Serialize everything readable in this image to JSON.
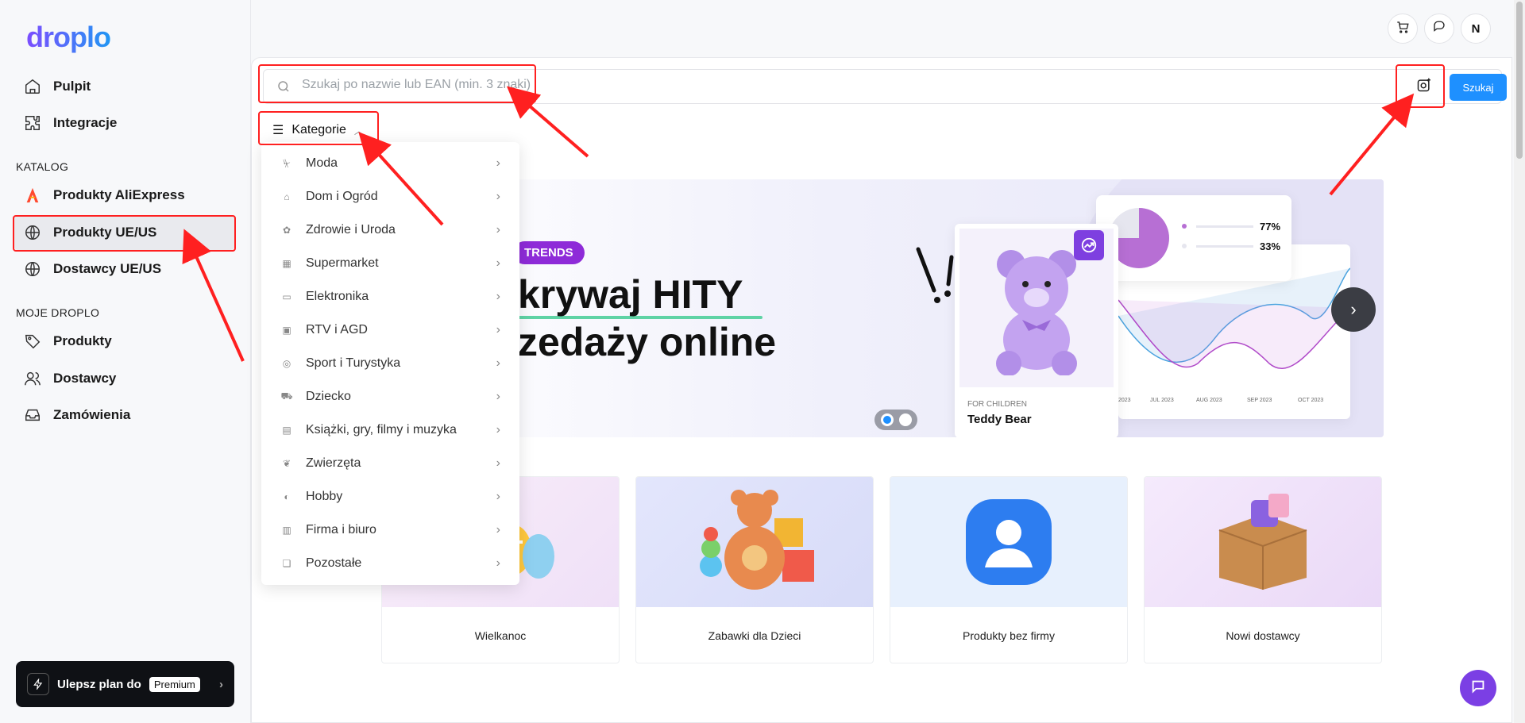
{
  "app": {
    "logo": "droplo",
    "user_initial": "N"
  },
  "sidebar": {
    "top_items": [
      {
        "label": "Pulpit",
        "icon": "home-icon"
      },
      {
        "label": "Integracje",
        "icon": "puzzle-icon"
      }
    ],
    "section_catalog": "KATALOG",
    "catalog_items": [
      {
        "label": "Produkty AliExpress",
        "icon": "aliexpress-icon"
      },
      {
        "label": "Produkty UE/US",
        "icon": "globe-icon",
        "active": true
      },
      {
        "label": "Dostawcy UE/US",
        "icon": "globe-icon"
      }
    ],
    "section_mine": "MOJE DROPLO",
    "mine_items": [
      {
        "label": "Produkty",
        "icon": "tag-icon"
      },
      {
        "label": "Dostawcy",
        "icon": "users-icon"
      },
      {
        "label": "Zamówienia",
        "icon": "inbox-icon"
      }
    ],
    "upgrade": {
      "label": "Ulepsz plan do",
      "badge": "Premium"
    }
  },
  "search": {
    "placeholder": "Szukaj po nazwie lub EAN (min. 3 znaki)",
    "value": "",
    "button": "Szukaj"
  },
  "categories": {
    "toggle_label": "Kategorie",
    "items": [
      "Moda",
      "Dom i Ogród",
      "Zdrowie i Uroda",
      "Supermarket",
      "Elektronika",
      "RTV i AGD",
      "Sport i Turystyka",
      "Dziecko",
      "Książki, gry, filmy i muzyka",
      "Zwierzęta",
      "Hobby",
      "Firma i biuro",
      "Pozostałe"
    ]
  },
  "banner": {
    "badge": "TRENDS",
    "line1": "krywaj HITY",
    "line2": "zedaży online",
    "card_caption": "FOR CHILDREN",
    "card_title": "Teddy Bear",
    "pie_values": [
      "77%",
      "33%"
    ],
    "months": [
      "2023",
      "JUL 2023",
      "AUG 2023",
      "SEP 2023",
      "OCT 2023"
    ],
    "slides": 2,
    "current_slide": 1
  },
  "tiles": [
    {
      "label": "Wielkanoc"
    },
    {
      "label": "Zabawki dla Dzieci"
    },
    {
      "label": "Produkty bez firmy"
    },
    {
      "label": "Nowi dostawcy"
    }
  ],
  "colors": {
    "accent": "#1e90ff",
    "brand_purple": "#7b3fe4",
    "annotation_red": "#ff2020"
  }
}
